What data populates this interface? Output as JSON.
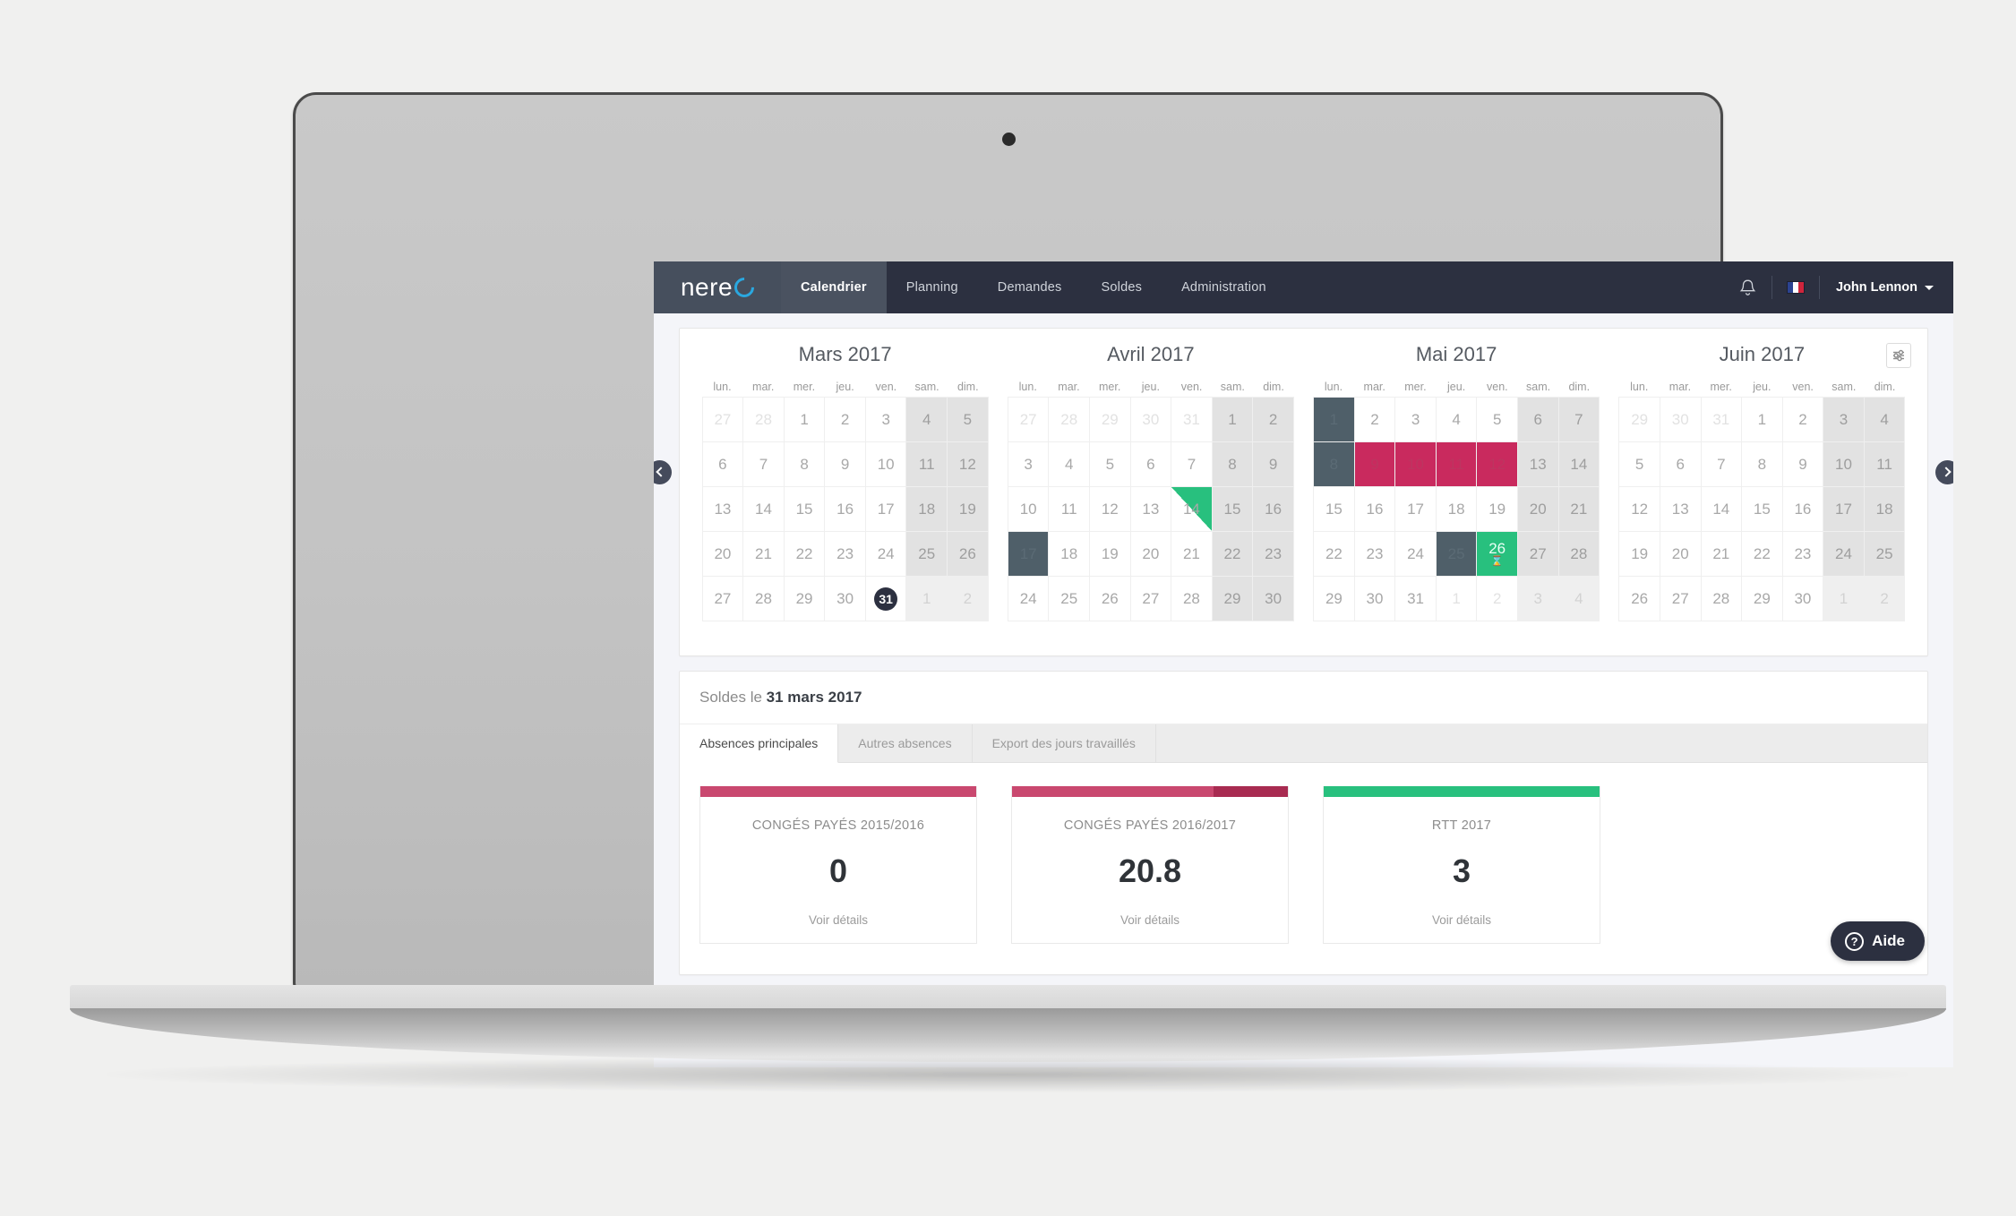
{
  "navbar": {
    "logo_text": "nere",
    "logo_icon": "nereo-logo-o",
    "links": [
      {
        "label": "Calendrier",
        "active": true
      },
      {
        "label": "Planning",
        "active": false
      },
      {
        "label": "Demandes",
        "active": false
      },
      {
        "label": "Soldes",
        "active": false
      },
      {
        "label": "Administration",
        "active": false
      }
    ],
    "notification_icon": "bell-icon",
    "language_icon": "french-flag-icon",
    "user_name": "John Lennon",
    "user_caret_icon": "caret-down-icon"
  },
  "calendar": {
    "filter_icon": "sliders-icon",
    "prev_icon": "chevron-left-icon",
    "next_icon": "chevron-right-icon",
    "weekdays": [
      "lun.",
      "mar.",
      "mer.",
      "jeu.",
      "ven.",
      "sam.",
      "dim."
    ],
    "legend_colors": {
      "holiday": "#4f5f69",
      "absence": "#c92a5e",
      "rtt": "#28c07e",
      "weekend": "#e2e2e2",
      "today": "#2c3040"
    },
    "months": [
      {
        "title": "Mars 2017",
        "days": [
          {
            "n": "27",
            "s": "out"
          },
          {
            "n": "28",
            "s": "out"
          },
          {
            "n": "1",
            "s": ""
          },
          {
            "n": "2",
            "s": ""
          },
          {
            "n": "3",
            "s": ""
          },
          {
            "n": "4",
            "s": "weekend"
          },
          {
            "n": "5",
            "s": "weekend"
          },
          {
            "n": "6",
            "s": ""
          },
          {
            "n": "7",
            "s": ""
          },
          {
            "n": "8",
            "s": ""
          },
          {
            "n": "9",
            "s": ""
          },
          {
            "n": "10",
            "s": ""
          },
          {
            "n": "11",
            "s": "weekend"
          },
          {
            "n": "12",
            "s": "weekend"
          },
          {
            "n": "13",
            "s": ""
          },
          {
            "n": "14",
            "s": ""
          },
          {
            "n": "15",
            "s": ""
          },
          {
            "n": "16",
            "s": ""
          },
          {
            "n": "17",
            "s": ""
          },
          {
            "n": "18",
            "s": "weekend"
          },
          {
            "n": "19",
            "s": "weekend"
          },
          {
            "n": "20",
            "s": ""
          },
          {
            "n": "21",
            "s": ""
          },
          {
            "n": "22",
            "s": ""
          },
          {
            "n": "23",
            "s": ""
          },
          {
            "n": "24",
            "s": ""
          },
          {
            "n": "25",
            "s": "weekend"
          },
          {
            "n": "26",
            "s": "weekend"
          },
          {
            "n": "27",
            "s": ""
          },
          {
            "n": "28",
            "s": ""
          },
          {
            "n": "29",
            "s": ""
          },
          {
            "n": "30",
            "s": ""
          },
          {
            "n": "31",
            "s": "today"
          },
          {
            "n": "1",
            "s": "weekend out"
          },
          {
            "n": "2",
            "s": "weekend out"
          }
        ]
      },
      {
        "title": "Avril 2017",
        "days": [
          {
            "n": "27",
            "s": "out"
          },
          {
            "n": "28",
            "s": "out"
          },
          {
            "n": "29",
            "s": "out"
          },
          {
            "n": "30",
            "s": "out"
          },
          {
            "n": "31",
            "s": "out"
          },
          {
            "n": "1",
            "s": "weekend"
          },
          {
            "n": "2",
            "s": "weekend"
          },
          {
            "n": "3",
            "s": ""
          },
          {
            "n": "4",
            "s": ""
          },
          {
            "n": "5",
            "s": ""
          },
          {
            "n": "6",
            "s": ""
          },
          {
            "n": "7",
            "s": ""
          },
          {
            "n": "8",
            "s": "weekend"
          },
          {
            "n": "9",
            "s": "weekend"
          },
          {
            "n": "10",
            "s": ""
          },
          {
            "n": "11",
            "s": ""
          },
          {
            "n": "12",
            "s": ""
          },
          {
            "n": "13",
            "s": ""
          },
          {
            "n": "14",
            "s": "half"
          },
          {
            "n": "15",
            "s": "weekend"
          },
          {
            "n": "16",
            "s": "weekend"
          },
          {
            "n": "17",
            "s": "holiday"
          },
          {
            "n": "18",
            "s": ""
          },
          {
            "n": "19",
            "s": ""
          },
          {
            "n": "20",
            "s": ""
          },
          {
            "n": "21",
            "s": ""
          },
          {
            "n": "22",
            "s": "weekend"
          },
          {
            "n": "23",
            "s": "weekend"
          },
          {
            "n": "24",
            "s": ""
          },
          {
            "n": "25",
            "s": ""
          },
          {
            "n": "26",
            "s": ""
          },
          {
            "n": "27",
            "s": ""
          },
          {
            "n": "28",
            "s": ""
          },
          {
            "n": "29",
            "s": "weekend"
          },
          {
            "n": "30",
            "s": "weekend"
          }
        ]
      },
      {
        "title": "Mai 2017",
        "days": [
          {
            "n": "1",
            "s": "holiday"
          },
          {
            "n": "2",
            "s": ""
          },
          {
            "n": "3",
            "s": ""
          },
          {
            "n": "4",
            "s": ""
          },
          {
            "n": "5",
            "s": ""
          },
          {
            "n": "6",
            "s": "weekend"
          },
          {
            "n": "7",
            "s": "weekend"
          },
          {
            "n": "8",
            "s": "holiday"
          },
          {
            "n": "9",
            "s": "absence"
          },
          {
            "n": "10",
            "s": "absence"
          },
          {
            "n": "11",
            "s": "absence"
          },
          {
            "n": "12",
            "s": "absence"
          },
          {
            "n": "13",
            "s": "weekend"
          },
          {
            "n": "14",
            "s": "weekend"
          },
          {
            "n": "15",
            "s": ""
          },
          {
            "n": "16",
            "s": ""
          },
          {
            "n": "17",
            "s": ""
          },
          {
            "n": "18",
            "s": ""
          },
          {
            "n": "19",
            "s": ""
          },
          {
            "n": "20",
            "s": "weekend"
          },
          {
            "n": "21",
            "s": "weekend"
          },
          {
            "n": "22",
            "s": ""
          },
          {
            "n": "23",
            "s": ""
          },
          {
            "n": "24",
            "s": ""
          },
          {
            "n": "25",
            "s": "holiday"
          },
          {
            "n": "26",
            "s": "rtt",
            "icon": "hourglass-icon"
          },
          {
            "n": "27",
            "s": "weekend"
          },
          {
            "n": "28",
            "s": "weekend"
          },
          {
            "n": "29",
            "s": ""
          },
          {
            "n": "30",
            "s": ""
          },
          {
            "n": "31",
            "s": ""
          },
          {
            "n": "1",
            "s": "out"
          },
          {
            "n": "2",
            "s": "out"
          },
          {
            "n": "3",
            "s": "weekend out"
          },
          {
            "n": "4",
            "s": "weekend out"
          }
        ]
      },
      {
        "title": "Juin 2017",
        "days": [
          {
            "n": "29",
            "s": "out"
          },
          {
            "n": "30",
            "s": "out"
          },
          {
            "n": "31",
            "s": "out"
          },
          {
            "n": "1",
            "s": ""
          },
          {
            "n": "2",
            "s": ""
          },
          {
            "n": "3",
            "s": "weekend"
          },
          {
            "n": "4",
            "s": "weekend"
          },
          {
            "n": "5",
            "s": ""
          },
          {
            "n": "6",
            "s": ""
          },
          {
            "n": "7",
            "s": ""
          },
          {
            "n": "8",
            "s": ""
          },
          {
            "n": "9",
            "s": ""
          },
          {
            "n": "10",
            "s": "weekend"
          },
          {
            "n": "11",
            "s": "weekend"
          },
          {
            "n": "12",
            "s": ""
          },
          {
            "n": "13",
            "s": ""
          },
          {
            "n": "14",
            "s": ""
          },
          {
            "n": "15",
            "s": ""
          },
          {
            "n": "16",
            "s": ""
          },
          {
            "n": "17",
            "s": "weekend"
          },
          {
            "n": "18",
            "s": "weekend"
          },
          {
            "n": "19",
            "s": ""
          },
          {
            "n": "20",
            "s": ""
          },
          {
            "n": "21",
            "s": ""
          },
          {
            "n": "22",
            "s": ""
          },
          {
            "n": "23",
            "s": ""
          },
          {
            "n": "24",
            "s": "weekend"
          },
          {
            "n": "25",
            "s": "weekend"
          },
          {
            "n": "26",
            "s": ""
          },
          {
            "n": "27",
            "s": ""
          },
          {
            "n": "28",
            "s": ""
          },
          {
            "n": "29",
            "s": ""
          },
          {
            "n": "30",
            "s": ""
          },
          {
            "n": "1",
            "s": "weekend out"
          },
          {
            "n": "2",
            "s": "weekend out"
          }
        ]
      }
    ]
  },
  "balances": {
    "header_prefix": "Soldes le ",
    "header_date": "31 mars 2017",
    "tabs": [
      {
        "label": "Absences principales",
        "active": true
      },
      {
        "label": "Autres absences",
        "active": false
      },
      {
        "label": "Export des jours travaillés",
        "active": false
      }
    ],
    "cards": [
      {
        "title": "CONGÉS PAYÉS 2015/2016",
        "value": "0",
        "link": "Voir détails",
        "bar_color": "#c9486f",
        "bar_color_2": "#c9486f",
        "bar_split_pct": 100
      },
      {
        "title": "CONGÉS PAYÉS 2016/2017",
        "value": "20.8",
        "link": "Voir détails",
        "bar_color": "#c9486f",
        "bar_color_2": "#a82b51",
        "bar_split_pct": 73
      },
      {
        "title": "RTT 2017",
        "value": "3",
        "link": "Voir détails",
        "bar_color": "#28c07e",
        "bar_color_2": "#28c07e",
        "bar_split_pct": 100
      }
    ]
  },
  "help": {
    "label": "Aide",
    "icon": "question-mark-icon"
  }
}
